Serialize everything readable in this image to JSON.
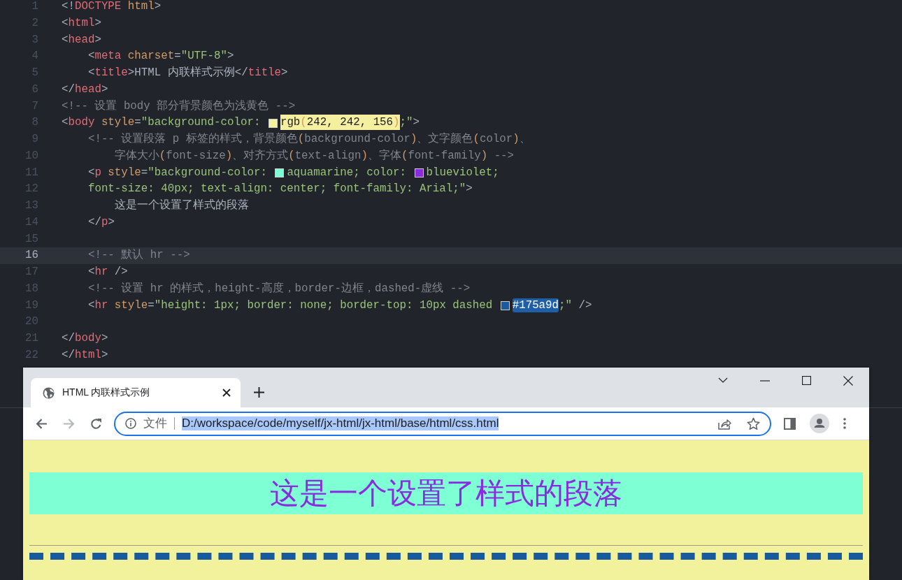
{
  "editor": {
    "lines": [
      {
        "number": "1",
        "current": false,
        "tokens": [
          {
            "kind": "punct",
            "text": "<!"
          },
          {
            "kind": "tag",
            "text": "DOCTYPE"
          },
          {
            "kind": "attr",
            "text": " html"
          },
          {
            "kind": "punct",
            "text": ">"
          }
        ]
      },
      {
        "number": "2",
        "current": false,
        "tokens": [
          {
            "kind": "punct",
            "text": "<"
          },
          {
            "kind": "tag",
            "text": "html"
          },
          {
            "kind": "punct",
            "text": ">"
          }
        ]
      },
      {
        "number": "3",
        "current": false,
        "tokens": [
          {
            "kind": "punct",
            "text": "<"
          },
          {
            "kind": "tag",
            "text": "head"
          },
          {
            "kind": "punct",
            "text": ">"
          }
        ]
      },
      {
        "number": "4",
        "current": false,
        "tokens": [
          {
            "kind": "punct",
            "text": "    <"
          },
          {
            "kind": "tag",
            "text": "meta"
          },
          {
            "kind": "attr",
            "text": " charset"
          },
          {
            "kind": "punct",
            "text": "="
          },
          {
            "kind": "string",
            "text": "\"UTF-8\""
          },
          {
            "kind": "punct",
            "text": ">"
          }
        ]
      },
      {
        "number": "5",
        "current": false,
        "tokens": [
          {
            "kind": "punct",
            "text": "    <"
          },
          {
            "kind": "tag",
            "text": "title"
          },
          {
            "kind": "punct",
            "text": ">"
          },
          {
            "kind": "text",
            "text": "HTML 内联样式示例"
          },
          {
            "kind": "punct",
            "text": "</"
          },
          {
            "kind": "tag",
            "text": "title"
          },
          {
            "kind": "punct",
            "text": ">"
          }
        ]
      },
      {
        "number": "6",
        "current": false,
        "tokens": [
          {
            "kind": "punct",
            "text": "</"
          },
          {
            "kind": "tag",
            "text": "head"
          },
          {
            "kind": "punct",
            "text": ">"
          }
        ]
      },
      {
        "number": "7",
        "current": false,
        "tokens": [
          {
            "kind": "comment",
            "text": "<!-- 设置 body 部分背景颜色为浅黄色 -->"
          }
        ]
      },
      {
        "number": "8",
        "current": false,
        "tokens": [
          {
            "kind": "punct",
            "text": "<"
          },
          {
            "kind": "tag",
            "text": "body"
          },
          {
            "kind": "attr",
            "text": " style"
          },
          {
            "kind": "punct",
            "text": "="
          },
          {
            "kind": "string",
            "text": "\"background-color: "
          },
          {
            "kind": "swatch",
            "color": "#f2f29c"
          },
          {
            "kind": "match",
            "text": "rgb"
          },
          {
            "kind": "match-bracket",
            "text": "("
          },
          {
            "kind": "match",
            "text": "242, 242, 156"
          },
          {
            "kind": "match-bracket",
            "text": ")"
          },
          {
            "kind": "string",
            "text": ";\""
          },
          {
            "kind": "punct",
            "text": ">"
          }
        ]
      },
      {
        "number": "9",
        "current": false,
        "tokens": [
          {
            "kind": "comment",
            "text": "    <!-- 设置段落 p 标签的样式，背景颜色"
          },
          {
            "kind": "bracket",
            "text": "("
          },
          {
            "kind": "comment",
            "text": "background-color"
          },
          {
            "kind": "bracket",
            "text": ")"
          },
          {
            "kind": "comment",
            "text": "、文字颜色"
          },
          {
            "kind": "bracket",
            "text": "("
          },
          {
            "kind": "comment",
            "text": "color"
          },
          {
            "kind": "bracket",
            "text": ")"
          },
          {
            "kind": "comment",
            "text": "、"
          }
        ]
      },
      {
        "number": "10",
        "current": false,
        "tokens": [
          {
            "kind": "comment",
            "text": "        字体大小"
          },
          {
            "kind": "bracket",
            "text": "("
          },
          {
            "kind": "comment",
            "text": "font-size"
          },
          {
            "kind": "bracket",
            "text": ")"
          },
          {
            "kind": "comment",
            "text": "、对齐方式"
          },
          {
            "kind": "bracket",
            "text": "("
          },
          {
            "kind": "comment",
            "text": "text-align"
          },
          {
            "kind": "bracket",
            "text": ")"
          },
          {
            "kind": "comment",
            "text": "、字体"
          },
          {
            "kind": "bracket",
            "text": "("
          },
          {
            "kind": "comment",
            "text": "font-family"
          },
          {
            "kind": "bracket",
            "text": ")"
          },
          {
            "kind": "comment",
            "text": " -->"
          }
        ]
      },
      {
        "number": "11",
        "current": false,
        "tokens": [
          {
            "kind": "punct",
            "text": "    <"
          },
          {
            "kind": "tag",
            "text": "p"
          },
          {
            "kind": "attr",
            "text": " style"
          },
          {
            "kind": "punct",
            "text": "="
          },
          {
            "kind": "string",
            "text": "\"background-color: "
          },
          {
            "kind": "swatch",
            "color": "#7fffd4"
          },
          {
            "kind": "string",
            "text": "aquamarine; color: "
          },
          {
            "kind": "swatch",
            "color": "#8a2be2"
          },
          {
            "kind": "string",
            "text": "blueviolet;"
          }
        ]
      },
      {
        "number": "12",
        "current": false,
        "tokens": [
          {
            "kind": "string",
            "text": "    font-size: 40px; text-align: center; font-family: Arial;\""
          },
          {
            "kind": "punct",
            "text": ">"
          }
        ]
      },
      {
        "number": "13",
        "current": false,
        "tokens": [
          {
            "kind": "text",
            "text": "        这是一个设置了样式的段落"
          }
        ]
      },
      {
        "number": "14",
        "current": false,
        "tokens": [
          {
            "kind": "punct",
            "text": "    </"
          },
          {
            "kind": "tag",
            "text": "p"
          },
          {
            "kind": "punct",
            "text": ">"
          }
        ]
      },
      {
        "number": "15",
        "current": false
      },
      {
        "number": "16",
        "current": true,
        "tokens": [
          {
            "kind": "comment",
            "text": "    <!-- 默认 hr -->"
          }
        ]
      },
      {
        "number": "17",
        "current": false,
        "tokens": [
          {
            "kind": "punct",
            "text": "    <"
          },
          {
            "kind": "tag",
            "text": "hr"
          },
          {
            "kind": "punct",
            "text": " />"
          }
        ]
      },
      {
        "number": "18",
        "current": false,
        "tokens": [
          {
            "kind": "comment",
            "text": "    <!-- 设置 hr 的样式，height-高度，border-边框，dashed-虚线 -->"
          }
        ]
      },
      {
        "number": "19",
        "current": false,
        "tokens": [
          {
            "kind": "punct",
            "text": "    <"
          },
          {
            "kind": "tag",
            "text": "hr"
          },
          {
            "kind": "attr",
            "text": " style"
          },
          {
            "kind": "punct",
            "text": "="
          },
          {
            "kind": "string",
            "text": "\"height: 1px; border: none; border-top: 10px dashed "
          },
          {
            "kind": "swatch",
            "color": "#175a9d"
          },
          {
            "kind": "selection",
            "text": "#175a9d"
          },
          {
            "kind": "string",
            "text": ";\""
          },
          {
            "kind": "punct",
            "text": " />"
          }
        ]
      },
      {
        "number": "20",
        "current": false
      },
      {
        "number": "21",
        "current": false,
        "tokens": [
          {
            "kind": "punct",
            "text": "</"
          },
          {
            "kind": "tag",
            "text": "body"
          },
          {
            "kind": "punct",
            "text": ">"
          }
        ]
      },
      {
        "number": "22",
        "current": false,
        "tokens": [
          {
            "kind": "punct",
            "text": "</"
          },
          {
            "kind": "tag",
            "text": "html"
          },
          {
            "kind": "punct",
            "text": ">"
          }
        ]
      }
    ]
  },
  "browser": {
    "tab": {
      "title": "HTML 内联样式示例"
    },
    "nav_buttons": [
      {
        "kind": "back",
        "disabled": false
      },
      {
        "kind": "forward",
        "disabled": true
      },
      {
        "kind": "reload",
        "disabled": false
      }
    ],
    "address": {
      "scheme": "文件",
      "url": "D:/workspace/code/myself/jx-html/jx-html/base/html/css.html",
      "selected": true
    },
    "page": {
      "paragraph": "这是一个设置了样式的段落",
      "rules": [
        {
          "kind": "default"
        },
        {
          "kind": "dashed"
        }
      ]
    }
  }
}
